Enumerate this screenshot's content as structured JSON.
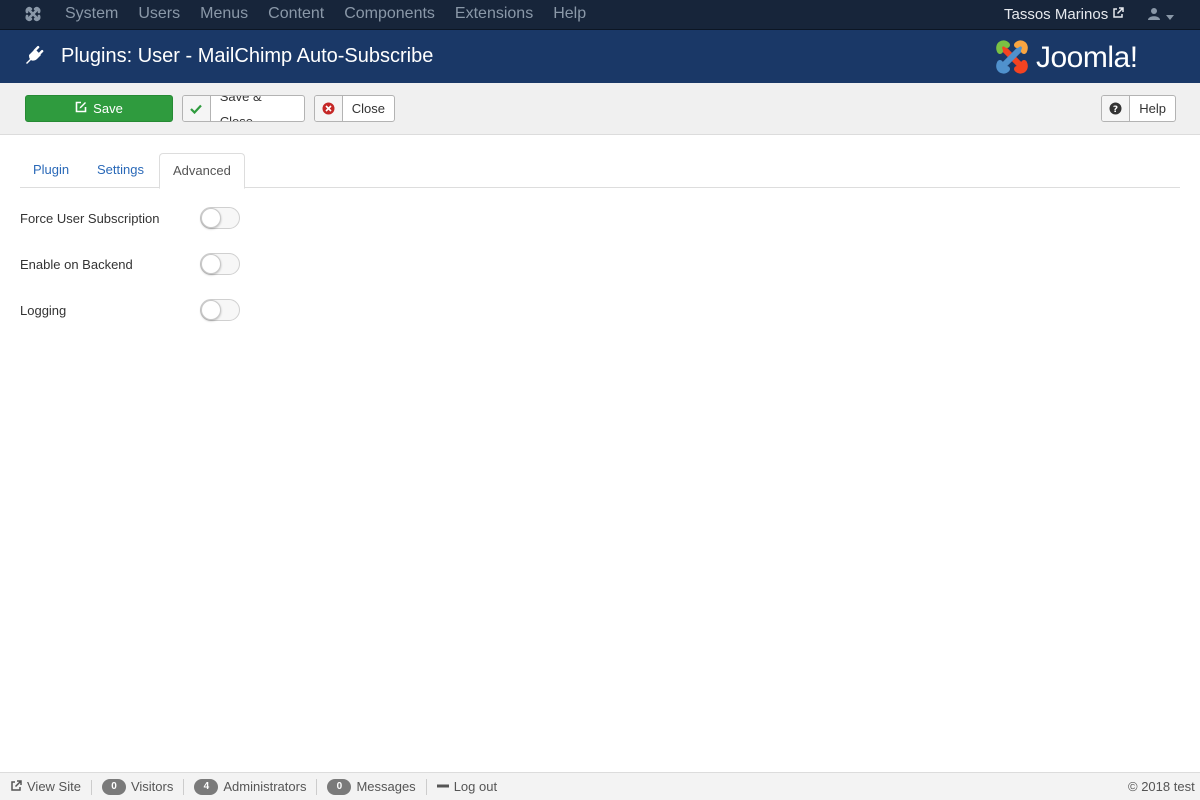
{
  "nav": {
    "items": [
      "System",
      "Users",
      "Menus",
      "Content",
      "Components",
      "Extensions",
      "Help"
    ],
    "user_name": "Tassos Marinos"
  },
  "header": {
    "title": "Plugins: User - MailChimp Auto-Subscribe",
    "brand": "Joomla!"
  },
  "toolbar": {
    "save_label": "Save",
    "save_close_label": "Save & Close",
    "close_label": "Close",
    "help_label": "Help"
  },
  "tabs": [
    {
      "label": "Plugin",
      "active": false
    },
    {
      "label": "Settings",
      "active": false
    },
    {
      "label": "Advanced",
      "active": true
    }
  ],
  "fields": [
    {
      "label": "Force User Subscription",
      "enabled": false
    },
    {
      "label": "Enable on Backend",
      "enabled": false
    },
    {
      "label": "Logging",
      "enabled": false
    }
  ],
  "status_bar": {
    "view_site": "View Site",
    "visitors_count": "0",
    "visitors_label": "Visitors",
    "admins_count": "4",
    "admins_label": "Administrators",
    "messages_count": "0",
    "messages_label": "Messages",
    "logout": "Log out",
    "copyright": "© 2018 test"
  },
  "colors": {
    "nav_bg": "#17253a",
    "header_bg": "#1a3867",
    "save_green": "#2f9b3e",
    "link_blue": "#2a69b8"
  }
}
